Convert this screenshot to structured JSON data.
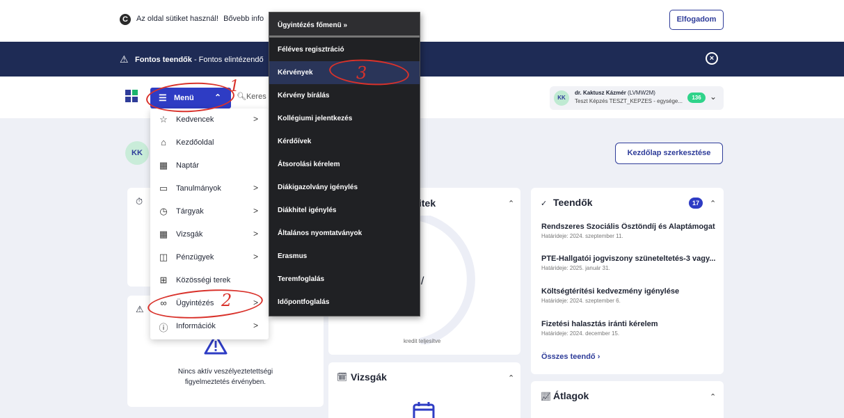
{
  "cookie": {
    "icon": "cookie-icon",
    "text": "Az oldal sütiket használ!",
    "link": "Bővebb info",
    "accept": "Elfogadom"
  },
  "alert": {
    "icon": "warning-icon",
    "title": "Fontos teendők",
    "text": "- Fontos elintézendő"
  },
  "header": {
    "menu_label": "Menü",
    "search_placeholder": "Keres",
    "user": {
      "initials": "KK",
      "name": "dr. Kaktusz Kázmér",
      "code": "(LVMW2M)",
      "sub": "Teszt Képzés TESZT_KEPZES - egysége...",
      "badge": "136"
    }
  },
  "home": {
    "avatar": "KK",
    "edit_button": "Kezdőlap szerkesztése"
  },
  "menu": {
    "items": [
      {
        "icon": "star-icon",
        "label": "Kedvencek",
        "arrow": ">"
      },
      {
        "icon": "home-icon",
        "label": "Kezdőoldal",
        "arrow": ""
      },
      {
        "icon": "calendar-icon",
        "label": "Naptár",
        "arrow": ""
      },
      {
        "icon": "monitor-icon",
        "label": "Tanulmányok",
        "arrow": ">"
      },
      {
        "icon": "clock-icon",
        "label": "Tárgyak",
        "arrow": ">"
      },
      {
        "icon": "calendar-icon",
        "label": "Vizsgák",
        "arrow": ">"
      },
      {
        "icon": "wallet-icon",
        "label": "Pénzügyek",
        "arrow": ">"
      },
      {
        "icon": "community-icon",
        "label": "Közösségi terek",
        "arrow": ""
      },
      {
        "icon": "glasses-icon",
        "label": "Ügyintézés",
        "arrow": ">"
      },
      {
        "icon": "info-icon",
        "label": "Információk",
        "arrow": ">"
      }
    ]
  },
  "submenu": {
    "head": "Ügyintézés főmenü »",
    "items": [
      "Féléves regisztráció",
      "Kérvények",
      "Kérvény bírálás",
      "Kollégiumi jelentkezés",
      "Kérdőívek",
      "Átsorolási kérelem",
      "Diákigazolvány igénylés",
      "Diákhitel igénylés",
      "Általános nyomtatványok",
      "Erasmus",
      "Teremfoglalás",
      "Időpontfoglalás"
    ]
  },
  "credits": {
    "title": "itek",
    "slash": "/",
    "caption": "kredit teljesítve"
  },
  "exams": {
    "title": "Vizsgák"
  },
  "todos": {
    "title": "Teendők",
    "badge": "17",
    "items": [
      {
        "title": "Rendszeres Szociális Ösztöndíj és Alaptámogatá...",
        "date": "Határideje: 2024. szeptember 11."
      },
      {
        "title": "PTE-Hallgatói jogviszony szüneteltetés-3 vagy...",
        "date": "Határideje: 2025. január 31."
      },
      {
        "title": "Költségtérítési kedvezmény igénylése",
        "date": "Határideje: 2024. szeptember 6."
      },
      {
        "title": "Fizetési halasztás iránti kérelem",
        "date": "Határideje: 2024. december 15."
      }
    ],
    "all": "Összes teendő"
  },
  "averages": {
    "title": "Átlagok"
  },
  "warning": {
    "text": "Nincs aktív veszélyeztetettségi figyelmeztetés érvényben."
  },
  "annotations": [
    "1",
    "2",
    "3"
  ]
}
